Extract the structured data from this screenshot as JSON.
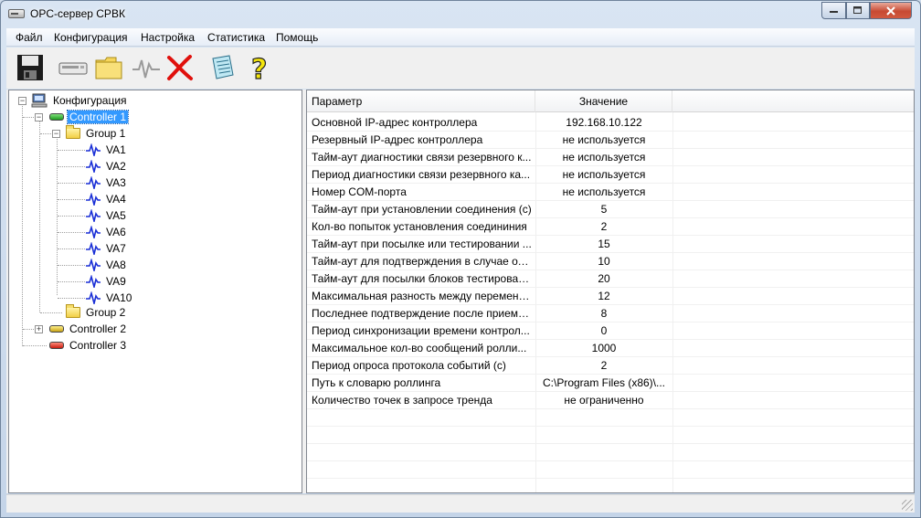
{
  "window": {
    "title": "OPC-сервер СРВК"
  },
  "menu": [
    "Файл",
    "Конфигурация",
    "Настройка",
    "Статистика",
    "Помощь"
  ],
  "toolbar": [
    {
      "icon": "save-icon"
    },
    {
      "icon": "controller-icon"
    },
    {
      "icon": "open-folder-icon"
    },
    {
      "icon": "signal-icon"
    },
    {
      "icon": "delete-icon"
    },
    {
      "icon": "notepad-icon"
    },
    {
      "icon": "help-icon"
    }
  ],
  "tree": {
    "root": "Конфигурация",
    "controller1": "Controller 1",
    "group1": "Group 1",
    "tags": [
      "VA1",
      "VA2",
      "VA3",
      "VA4",
      "VA5",
      "VA6",
      "VA7",
      "VA8",
      "VA9",
      "VA10"
    ],
    "group2": "Group 2",
    "controller2": "Controller 2",
    "controller3": "Controller 3"
  },
  "list": {
    "headers": {
      "param": "Параметр",
      "value": "Значение"
    },
    "rows": [
      {
        "param": "Основной IP-адрес контроллера",
        "value": "192.168.10.122"
      },
      {
        "param": "Резервный IP-адрес контроллера",
        "value": "не используется"
      },
      {
        "param": "Тайм-аут диагностики связи резервного к...",
        "value": "не используется"
      },
      {
        "param": "Период диагностики связи резервного ка...",
        "value": "не используется"
      },
      {
        "param": "Номер COM-порта",
        "value": "не используется"
      },
      {
        "param": "Тайм-аут при установлении соединения (с)",
        "value": "5"
      },
      {
        "param": "Кол-во попыток установления соедининия",
        "value": "2"
      },
      {
        "param": "Тайм-аут при посылке или тестировании ...",
        "value": "15"
      },
      {
        "param": "Тайм-аут для подтверждения в случае отс...",
        "value": "10"
      },
      {
        "param": "Тайм-аут для посылки блоков тестирован...",
        "value": "20"
      },
      {
        "param": "Максимальная разность между переменн...",
        "value": "12"
      },
      {
        "param": "Последнее подтверждение после приема ...",
        "value": "8"
      },
      {
        "param": "Период синхронизации времени контрол...",
        "value": "0"
      },
      {
        "param": "Максимальное кол-во сообщений ролли...",
        "value": "1000"
      },
      {
        "param": "Период опроса протокола событий (с)",
        "value": "2"
      },
      {
        "param": "Путь к словарю роллинга",
        "value": "C:\\Program Files (x86)\\..."
      },
      {
        "param": "Количество точек в запросе тренда",
        "value": "не ограниченно"
      }
    ]
  }
}
